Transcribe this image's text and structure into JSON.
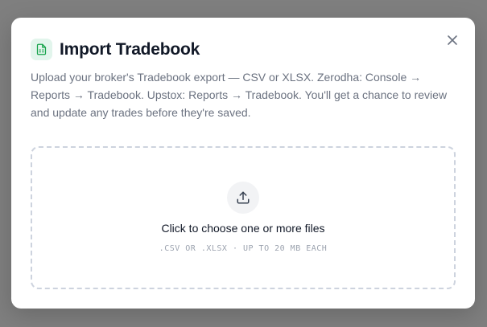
{
  "modal": {
    "title": "Import Tradebook",
    "title_icon": "spreadsheet-file-icon",
    "close_icon": "close-icon",
    "description": "Upload your broker's Tradebook export — CSV or XLSX. Zerodha: Console → Reports → Tradebook. Upstox: Reports → Tradebook. You'll get a chance to review and update any trades before they're saved."
  },
  "dropzone": {
    "icon": "upload-icon",
    "label": "Click to choose one or more files",
    "hint": ".CSV OR .XLSX · UP TO 20 MB EACH"
  },
  "colors": {
    "accent": "#16a34a",
    "accent_bg": "#e2f5ec",
    "overlay": "#7f7f7f"
  }
}
